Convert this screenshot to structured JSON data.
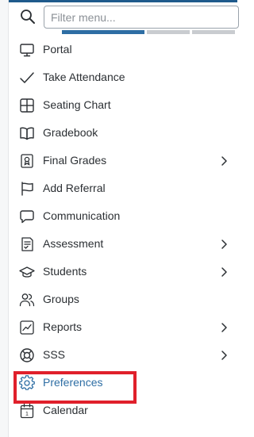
{
  "search": {
    "placeholder": "Filter menu...",
    "value": ""
  },
  "colors": {
    "accent": "#2e6ea4",
    "text": "#2b2f33",
    "highlight": "#e0202b",
    "tab_inactive": "#c9ccd0"
  },
  "menu": {
    "items": [
      {
        "label": "Portal",
        "icon": "monitor-icon",
        "has_submenu": false
      },
      {
        "label": "Take Attendance",
        "icon": "checkmark-icon",
        "has_submenu": false
      },
      {
        "label": "Seating Chart",
        "icon": "grid-icon",
        "has_submenu": false
      },
      {
        "label": "Gradebook",
        "icon": "book-icon",
        "has_submenu": false
      },
      {
        "label": "Final Grades",
        "icon": "certificate-icon",
        "has_submenu": true
      },
      {
        "label": "Add Referral",
        "icon": "flag-icon",
        "has_submenu": false
      },
      {
        "label": "Communication",
        "icon": "chat-bubble-icon",
        "has_submenu": false
      },
      {
        "label": "Assessment",
        "icon": "checklist-document-icon",
        "has_submenu": true
      },
      {
        "label": "Students",
        "icon": "graduation-cap-icon",
        "has_submenu": true
      },
      {
        "label": "Groups",
        "icon": "users-icon",
        "has_submenu": false
      },
      {
        "label": "Reports",
        "icon": "line-chart-icon",
        "has_submenu": true
      },
      {
        "label": "SSS",
        "icon": "lifebuoy-icon",
        "has_submenu": true
      },
      {
        "label": "Preferences",
        "icon": "gear-icon",
        "has_submenu": false,
        "selected": true
      },
      {
        "label": "Calendar",
        "icon": "calendar-icon",
        "has_submenu": false
      }
    ]
  }
}
